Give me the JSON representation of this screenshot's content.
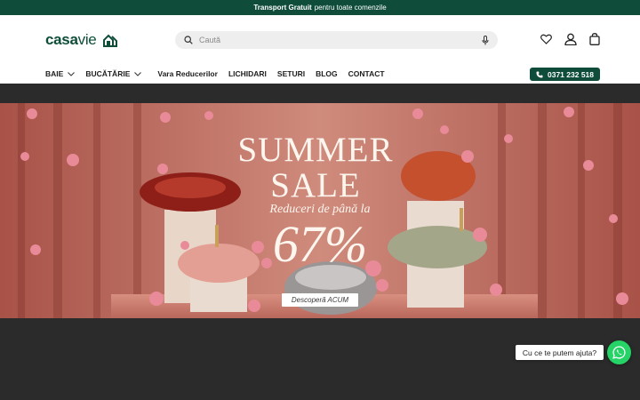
{
  "announcement": {
    "bold": "Transport Gratuit",
    "rest": "pentru toate comenzile"
  },
  "logo": {
    "part1": "casa",
    "part2": "vie",
    "icon": "house-icon"
  },
  "search": {
    "placeholder": "Caută",
    "icon": "search-icon",
    "mic_icon": "microphone-icon"
  },
  "header_icons": [
    "heart-icon",
    "user-icon",
    "cart-icon"
  ],
  "nav": [
    {
      "label": "BAIE",
      "dropdown": true
    },
    {
      "label": "BUCĂTĂRIE",
      "dropdown": true
    },
    {
      "label": "Vara Reducerilor",
      "dropdown": false
    },
    {
      "label": "LICHIDARI",
      "dropdown": false
    },
    {
      "label": "SETURI",
      "dropdown": false
    },
    {
      "label": "BLOG",
      "dropdown": false
    },
    {
      "label": "CONTACT",
      "dropdown": false
    }
  ],
  "phone": {
    "number": "0371 232 518",
    "icon": "phone-icon"
  },
  "hero": {
    "title_line1": "SUMMER",
    "title_line2": "SALE",
    "subtitle": "Reduceri de până la",
    "percent": "67%",
    "cta": "Descoperă ACUM"
  },
  "chat": {
    "bubble": "Cu ce te putem ajuta?",
    "icon": "whatsapp-icon"
  },
  "colors": {
    "brand": "#0f4d3a",
    "hero_bg": "#c2756a",
    "whatsapp": "#25d366",
    "dark_bg": "#2b2b2b"
  }
}
